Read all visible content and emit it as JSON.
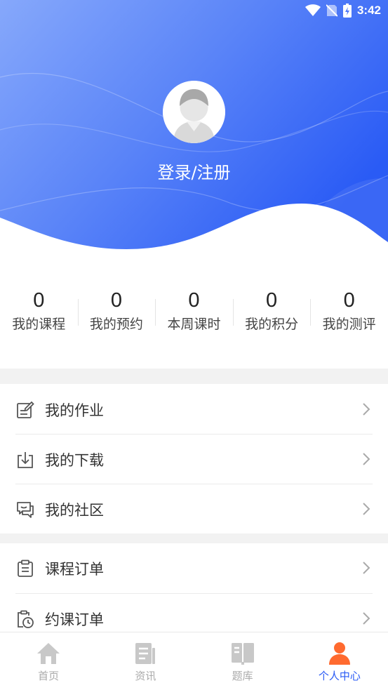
{
  "status_bar": {
    "time": "3:42"
  },
  "profile": {
    "login_label": "登录/注册"
  },
  "stats": [
    {
      "value": "0",
      "label": "我的课程"
    },
    {
      "value": "0",
      "label": "我的预约"
    },
    {
      "value": "0",
      "label": "本周课时"
    },
    {
      "value": "0",
      "label": "我的积分"
    },
    {
      "value": "0",
      "label": "我的测评"
    }
  ],
  "menu_group_1": [
    {
      "label": "我的作业",
      "icon": "edit-icon"
    },
    {
      "label": "我的下载",
      "icon": "download-icon"
    },
    {
      "label": "我的社区",
      "icon": "chat-icon"
    }
  ],
  "menu_group_2": [
    {
      "label": "课程订单",
      "icon": "clipboard-icon"
    },
    {
      "label": "约课订单",
      "icon": "schedule-icon"
    }
  ],
  "tabbar": [
    {
      "label": "首页",
      "icon": "home-icon",
      "active": false
    },
    {
      "label": "资讯",
      "icon": "news-icon",
      "active": false
    },
    {
      "label": "题库",
      "icon": "book-icon",
      "active": false
    },
    {
      "label": "个人中心",
      "icon": "person-icon",
      "active": true
    }
  ],
  "colors": {
    "header_gradient_start": "#7da1fb",
    "header_gradient_end": "#2a5bf5",
    "active_tab": "#2a5bf5",
    "active_icon": "#ff6a2f"
  }
}
